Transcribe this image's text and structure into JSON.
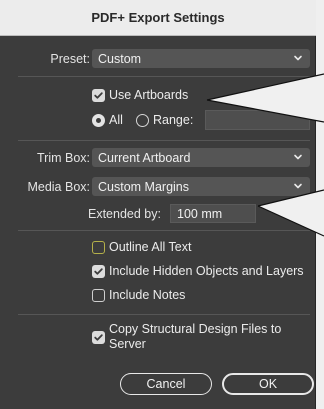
{
  "dialog": {
    "title": "PDF+ Export Settings"
  },
  "preset": {
    "label": "Preset:",
    "value": "Custom"
  },
  "artboards": {
    "use_label": "Use Artboards",
    "use_checked": true,
    "all_label": "All",
    "range_label": "Range:",
    "range_value": ""
  },
  "trim_box": {
    "label": "Trim Box:",
    "value": "Current Artboard"
  },
  "media_box": {
    "label": "Media Box:",
    "value": "Custom Margins"
  },
  "extended": {
    "label": "Extended by:",
    "value": "100 mm"
  },
  "options": {
    "outline_text": "Outline All Text",
    "hidden_objects": "Include Hidden Objects and Layers",
    "include_notes": "Include Notes"
  },
  "structural": {
    "line1": "Copy Structural Design Files to",
    "line2": "Server"
  },
  "buttons": {
    "cancel": "Cancel",
    "ok": "OK"
  },
  "colors": {
    "panel": "#3c3c3c",
    "outline_checkbox": "#b4b04a"
  }
}
